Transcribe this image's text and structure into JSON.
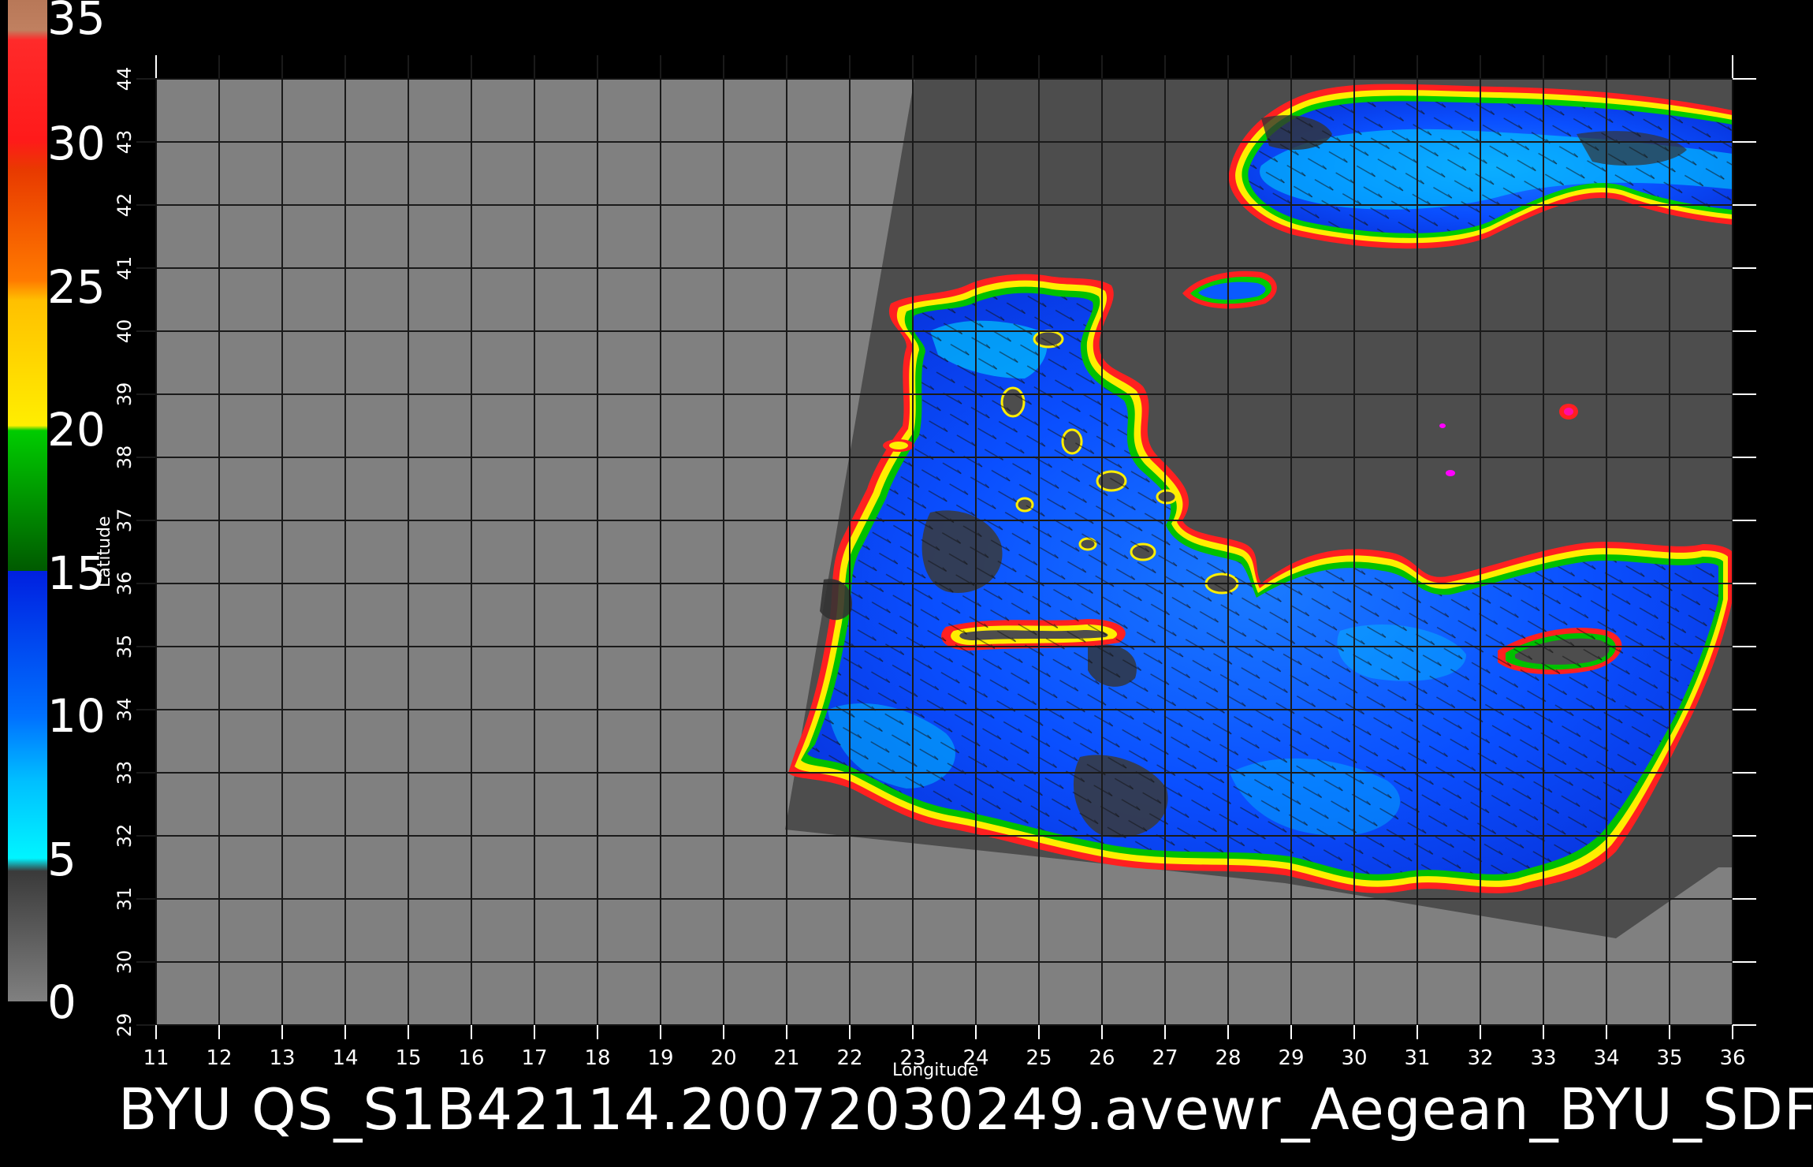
{
  "footer_text": "BYU  QS_S1B42114.20072030249.avewr_Aegean_BYU_SDF",
  "x_axis_label": "Longitude",
  "y_axis_label": "Latitude",
  "lon_ticks": [
    11,
    12,
    13,
    14,
    15,
    16,
    17,
    18,
    19,
    20,
    21,
    22,
    23,
    24,
    25,
    26,
    27,
    28,
    29,
    30,
    31,
    32,
    33,
    34,
    35,
    36
  ],
  "lat_ticks": [
    29,
    30,
    31,
    32,
    33,
    34,
    35,
    36,
    37,
    38,
    39,
    40,
    41,
    42,
    43,
    44
  ],
  "colorbar": {
    "labels": [
      "35",
      "30",
      "25",
      "20",
      "15",
      "10",
      "5",
      "0"
    ],
    "range": [
      0,
      35
    ],
    "colors": {
      "0-5": "#808080",
      "5-10": "#00ffff",
      "10-15": "#0044ff",
      "15-20": "#00aa00",
      "20-25": "#ffee00",
      "25-30": "#ff5500",
      "30-35": "#ff1010",
      "above": "#c08060"
    }
  },
  "colors": {
    "background": "#000000",
    "plot_background": "#808080",
    "swath": "#4d4d4d",
    "wind_low": "#00e5ff",
    "wind_mid": "#0a5aff",
    "coast_green": "#00b000",
    "coast_yellow": "#ffee00",
    "coast_red": "#ff1a1a",
    "vector": "#111111",
    "grid": "#1a1a1a"
  }
}
